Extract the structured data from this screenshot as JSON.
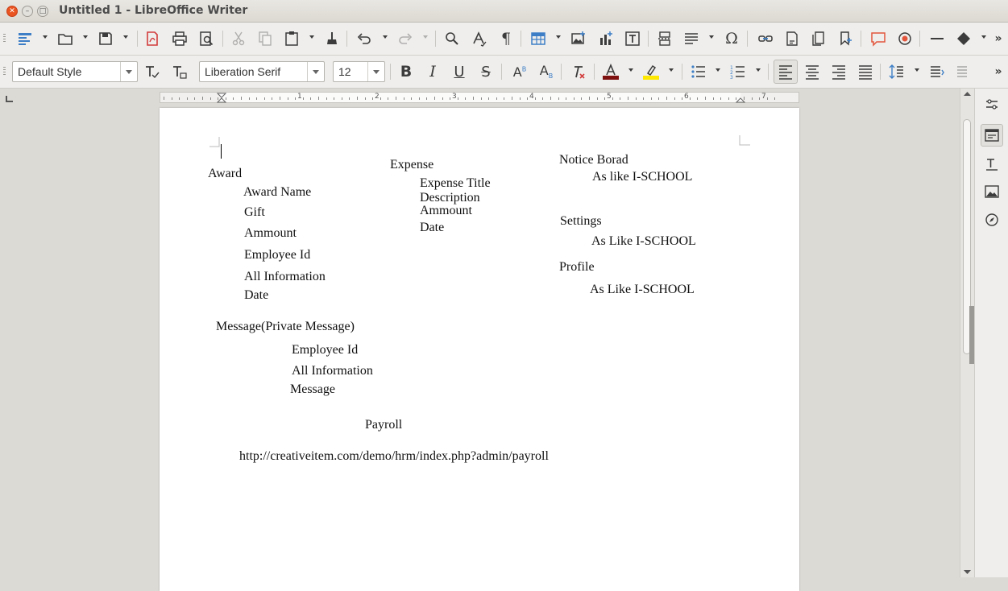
{
  "window": {
    "title": "Untitled 1 - LibreOffice Writer"
  },
  "formatting": {
    "paragraph_style": "Default Style",
    "font_name": "Liberation Serif",
    "font_size": "12"
  },
  "document": {
    "award": {
      "heading": "Award",
      "items": [
        "Award Name",
        "Gift",
        "Ammount",
        "Employee Id",
        "All Information",
        "Date"
      ]
    },
    "expense": {
      "heading": "Expense",
      "items": [
        "Expense Title",
        "Description",
        "Ammount",
        "Date"
      ]
    },
    "notice": {
      "heading": "Notice Borad",
      "detail": "As like I-SCHOOL"
    },
    "settings": {
      "heading": "Settings",
      "detail": "As Like I-SCHOOL"
    },
    "profile": {
      "heading": "Profile",
      "detail": "As Like I-SCHOOL"
    },
    "message": {
      "heading": "Message(Private Message)",
      "items": [
        "Employee Id",
        "All Information",
        "Message"
      ]
    },
    "payroll": {
      "heading": "Payroll",
      "url": "http://creativeitem.com/demo/hrm/index.php?admin/payroll"
    }
  },
  "ruler": {
    "numbers": [
      "1",
      "2",
      "3",
      "4",
      "5",
      "6",
      "7"
    ]
  },
  "colors": {
    "font_color": "#7f1010",
    "highlight_color": "#ffe800",
    "close_button": "#e95420"
  }
}
